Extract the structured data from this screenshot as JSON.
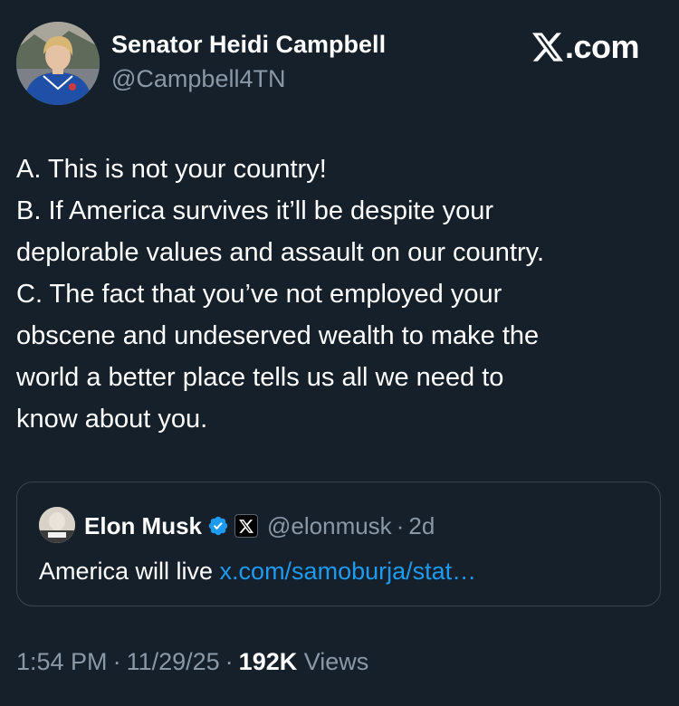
{
  "author": {
    "display_name": "Senator Heidi Campbell",
    "handle": "@Campbell4TN",
    "avatar_icon": "profile-photo"
  },
  "brand": {
    "icon": "x-logo-icon",
    "text": ".com"
  },
  "post": {
    "lines": [
      "A. This is not your country!",
      "B. If America survives it’ll be despite your",
      "deplorable values and assault on our country.",
      "C. The fact that you’ve not employed your",
      "obscene and undeserved wealth to make the",
      "world a better place tells us all we need to",
      "know about you."
    ]
  },
  "quoted_post": {
    "display_name": "Elon Musk",
    "verified_icon": "verified-badge-icon",
    "affiliation_icon": "x-affiliation-icon",
    "handle": "@elonmusk",
    "separator": "·",
    "time_ago": "2d",
    "text": "America will live ",
    "link": "x.com/samoburja/stat…"
  },
  "meta": {
    "time": "1:54 PM",
    "separator": "·",
    "date": "11/29/25",
    "views_count": "192K",
    "views_label": "Views"
  },
  "colors": {
    "background": "#15202b",
    "primary_text": "#ffffff",
    "secondary_text": "#8b98a5",
    "link": "#1d9bf0",
    "verified": "#1d9bf0",
    "border": "#38444d"
  }
}
